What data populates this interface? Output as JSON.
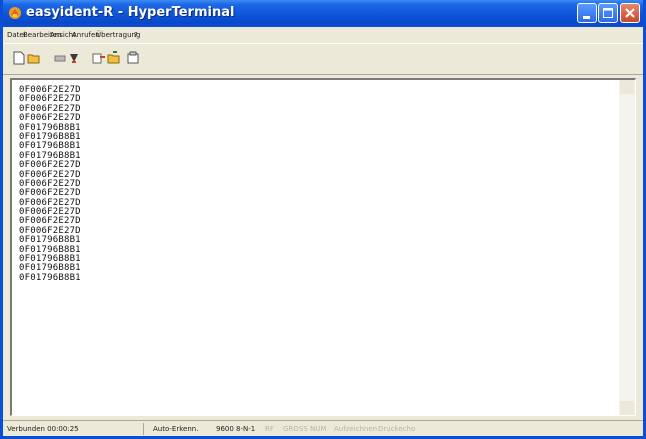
{
  "window": {
    "title": "easyident-R - HyperTerminal"
  },
  "menu": [
    "Datei",
    "Bearbeiten",
    "Ansicht",
    "Anrufen",
    "Übertragung",
    "?"
  ],
  "toolbar": {
    "icons": [
      "new-icon",
      "open-icon",
      "connect-icon",
      "disconnect-icon",
      "send-icon",
      "receive-icon",
      "properties-icon"
    ]
  },
  "terminal": {
    "lines": [
      "0F006F2E27D",
      "0F006F2E27D",
      "0F006F2E27D",
      "0F006F2E27D",
      "0F01796B8B1",
      "0F01796B8B1",
      "0F01796B8B1",
      "0F01796B8B1",
      "0F006F2E27D",
      "0F006F2E27D",
      "0F006F2E27D",
      "0F006F2E27D",
      "0F006F2E27D",
      "0F006F2E27D",
      "0F006F2E27D",
      "0F006F2E27D",
      "0F01796B8B1",
      "0F01796B8B1",
      "0F01796B8B1",
      "0F01796B8B1",
      "0F01796B8B1"
    ]
  },
  "status": {
    "connected": "Verbunden 00:00:25",
    "detect": "Auto-Erkenn.",
    "settings": "9600 8-N-1",
    "scroll": "RF",
    "caps": "GROSS",
    "num": "NUM",
    "capture": "Aufzeichnen",
    "echo": "Druckecho"
  }
}
